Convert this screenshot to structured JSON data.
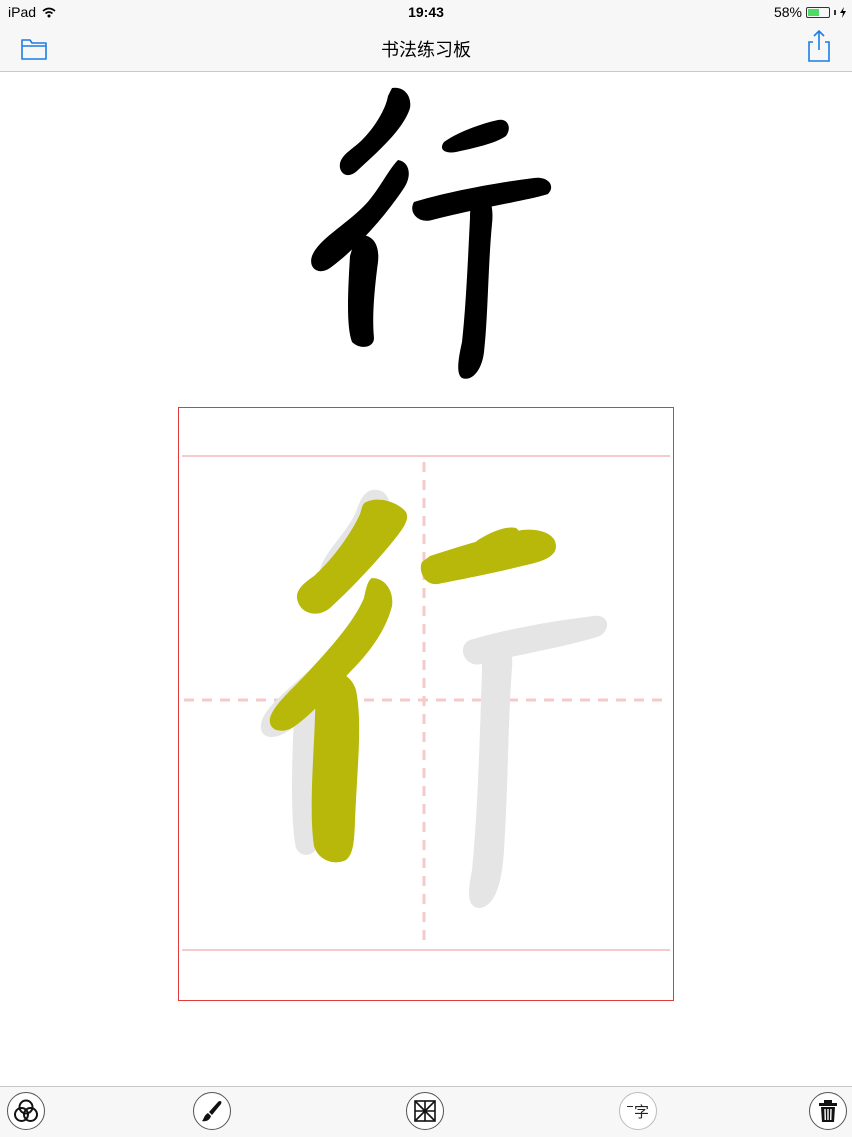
{
  "status_bar": {
    "device": "iPad",
    "time": "19:43",
    "battery_percent": "58%",
    "battery_level": 0.58,
    "battery_color": "#4cd964"
  },
  "nav": {
    "title": "书法练习板",
    "left_icon": "folder-icon",
    "right_icon": "share-icon",
    "accent_color": "#1a7ee6"
  },
  "reference": {
    "character": "行",
    "color": "#000000"
  },
  "practice": {
    "border_color": "#e03a3a",
    "guide_color": "#f6caca",
    "trace_color": "#b7b80a",
    "template_color": "#e5e5e5"
  },
  "toolbar": {
    "buttons": [
      {
        "icon": "rings-icon"
      },
      {
        "icon": "brush-icon"
      },
      {
        "icon": "grid-icon"
      },
      {
        "icon": "character-icon",
        "label": "字"
      },
      {
        "icon": "trash-icon"
      }
    ]
  }
}
